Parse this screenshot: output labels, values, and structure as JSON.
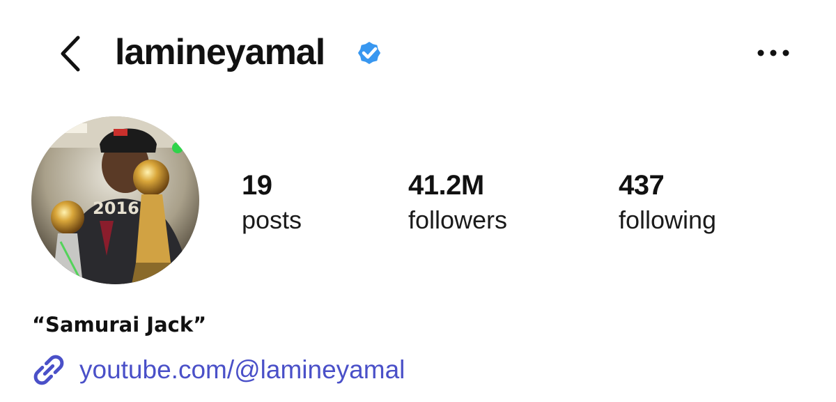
{
  "header": {
    "username": "lamineyamal",
    "verified": true,
    "back_icon": "chevron-left-icon",
    "more_icon": "ellipsis-icon"
  },
  "profile": {
    "stats": [
      {
        "value": "19",
        "label": "posts"
      },
      {
        "value": "41.2M",
        "label": "followers"
      },
      {
        "value": "437",
        "label": "following"
      }
    ],
    "display_name": "“Samurai Jack”",
    "link": {
      "icon": "link-icon",
      "text": "youtube.com/@lamineyamal"
    }
  },
  "colors": {
    "verified_badge": "#3897f0",
    "link": "#4a50c8",
    "text": "#111111",
    "background": "#ffffff"
  }
}
